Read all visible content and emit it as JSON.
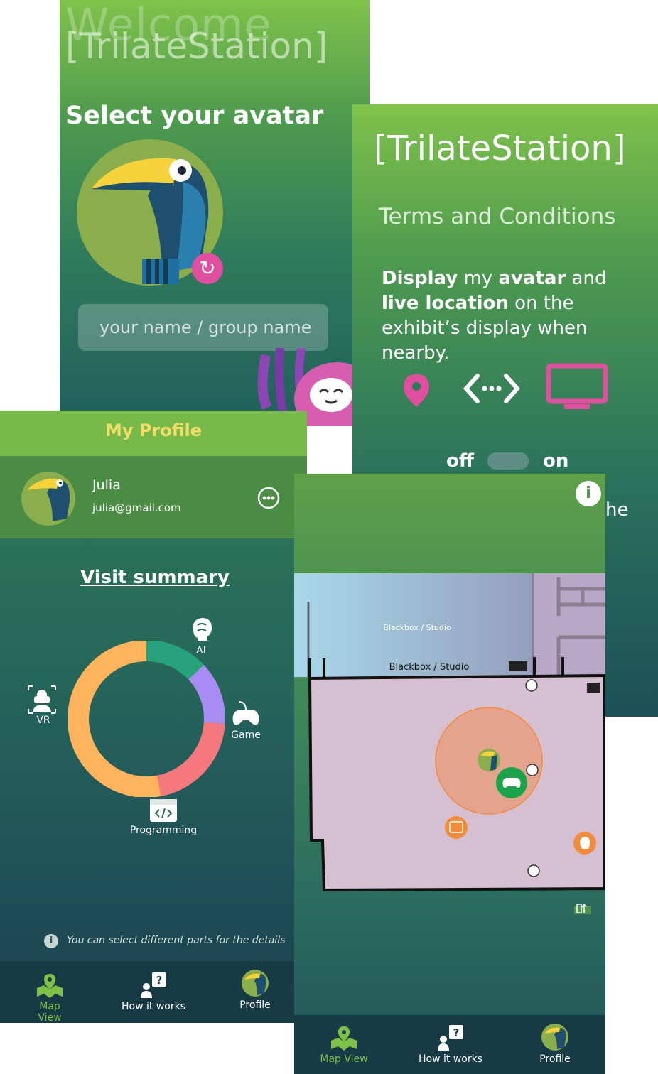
{
  "welcome": {
    "heading_faded": "Welcome",
    "brand": "[TrilateStation]",
    "select_avatar": "Select your avatar",
    "name_placeholder": "your name / group name",
    "refresh_icon": "refresh-icon"
  },
  "terms": {
    "brand": "[TrilateStation]",
    "title": "Terms and Conditions",
    "display_bold1": "Display",
    "display_text1": " my ",
    "display_bold2": "avatar",
    "display_text2": " and",
    "display_bold3": "live location",
    "display_text3": " on the exhibit’s display when nearby.",
    "toggle_off": "off",
    "toggle_on": "on",
    "fragment": "he",
    "icons": [
      "location-pin-icon",
      "connection-icon",
      "display-icon"
    ],
    "accent": "#e04ea0"
  },
  "profile": {
    "title": "My Profile",
    "user_name": "Julia",
    "user_email": "julia@gmail.com",
    "visit_summary": "Visit summary",
    "categories": {
      "ai": "AI",
      "game": "Game",
      "programming": "Programming",
      "vr": "VR"
    },
    "hint": "You can select different parts for the details",
    "title_color": "#f3dd6a"
  },
  "chart_data": {
    "type": "pie",
    "categories": [
      "AI",
      "Game",
      "Programming",
      "VR"
    ],
    "values": [
      13,
      13,
      21,
      53
    ],
    "colors": [
      "#26a37a",
      "#a88cf2",
      "#f5787f",
      "#ffb35c"
    ]
  },
  "map": {
    "room_upper": "Blackbox / Studio",
    "room_label": "Blackbox / Studio",
    "accent_orange": "#f38b3c",
    "game_marker": "#1aa34a"
  },
  "nav": {
    "map_view": "Map View",
    "how_it_works": "How it works",
    "profile": "Profile",
    "active_color": "#7fc24a"
  }
}
